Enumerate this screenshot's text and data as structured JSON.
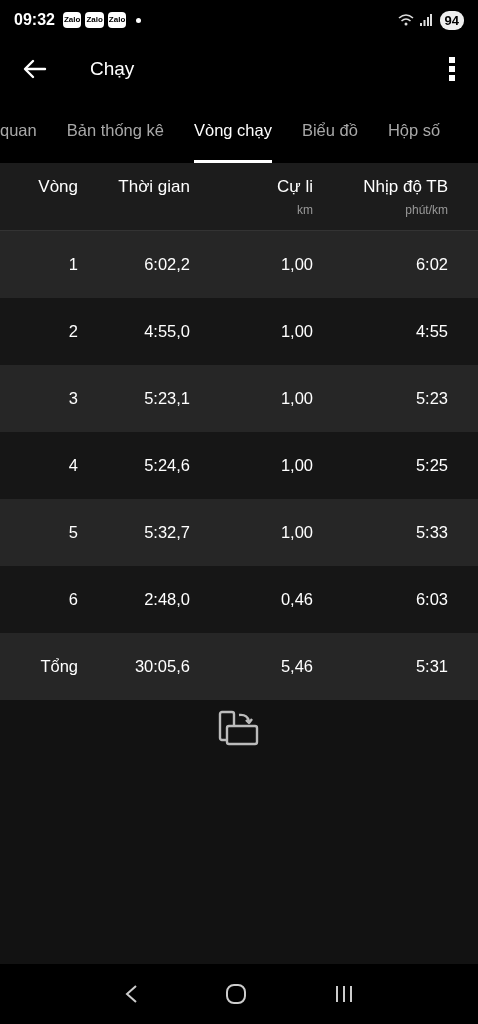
{
  "status_bar": {
    "time": "09:32",
    "notifications": [
      "Zalo",
      "Zalo",
      "Zalo"
    ],
    "battery": "94"
  },
  "header": {
    "title": "Chạy"
  },
  "tabs": [
    {
      "label": "quan",
      "selected": false
    },
    {
      "label": "Bản thống kê",
      "selected": false
    },
    {
      "label": "Vòng chạy",
      "selected": true
    },
    {
      "label": "Biểu đồ",
      "selected": false
    },
    {
      "label": "Hộp số",
      "selected": false
    }
  ],
  "table": {
    "columns": [
      {
        "label": "Vòng"
      },
      {
        "label": "Thời gian"
      },
      {
        "label": "Cự li",
        "unit": "km"
      },
      {
        "label": "Nhịp độ TB",
        "unit": "phút/km"
      }
    ],
    "rows": [
      {
        "cells": [
          "1",
          "6:02,2",
          "1,00",
          "6:02"
        ]
      },
      {
        "cells": [
          "2",
          "4:55,0",
          "1,00",
          "4:55"
        ]
      },
      {
        "cells": [
          "3",
          "5:23,1",
          "1,00",
          "5:23"
        ]
      },
      {
        "cells": [
          "4",
          "5:24,6",
          "1,00",
          "5:25"
        ]
      },
      {
        "cells": [
          "5",
          "5:32,7",
          "1,00",
          "5:33"
        ]
      },
      {
        "cells": [
          "6",
          "2:48,0",
          "0,46",
          "6:03"
        ]
      }
    ],
    "total": {
      "cells": [
        "Tổng",
        "30:05,6",
        "5,46",
        "5:31"
      ]
    }
  }
}
